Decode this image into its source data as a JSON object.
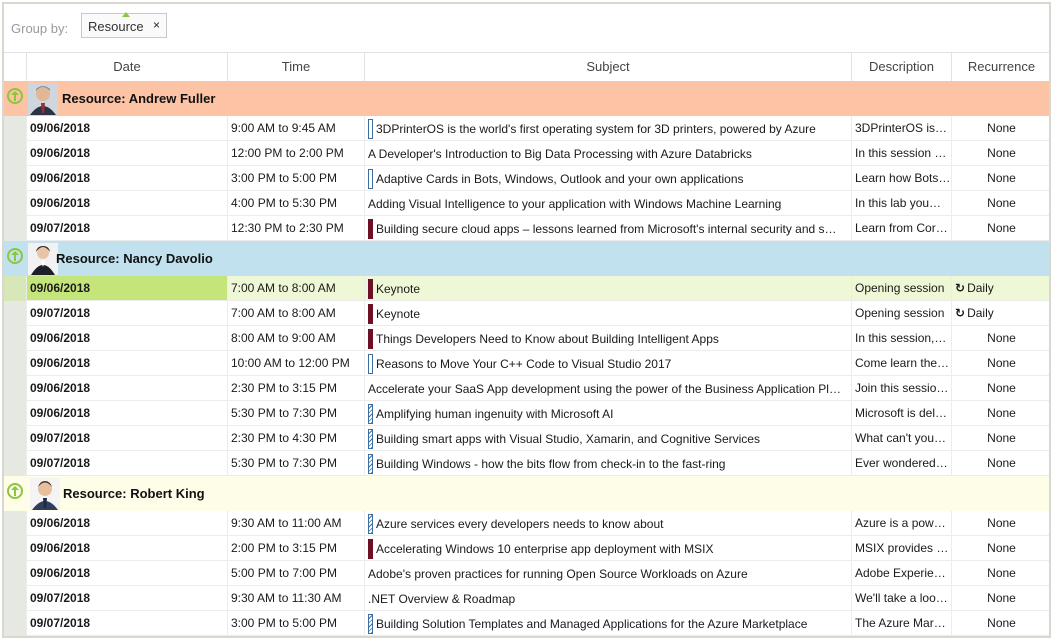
{
  "groupby": {
    "label": "Group by:",
    "chip_label": "Resource",
    "chip_close": "×"
  },
  "columns": [
    "Date",
    "Time",
    "Subject",
    "Description",
    "Recurrence"
  ],
  "groups": [
    {
      "title": "Resource: Andrew Fuller",
      "bg": "#fcc3a4",
      "rows": [
        {
          "date": "09/06/2018",
          "time": "9:00 AM to 9:45 AM",
          "cat": "hollow",
          "subject": "3DPrinterOS is the world's first operating system for 3D printers, powered by Azure",
          "description": "3DPrinterOS is…",
          "recurrence": "None"
        },
        {
          "date": "09/06/2018",
          "time": "12:00 PM to 2:00 PM",
          "cat": "none",
          "subject": "A Developer's Introduction to Big Data Processing with Azure Databricks",
          "description": "In this session y…",
          "recurrence": "None"
        },
        {
          "date": "09/06/2018",
          "time": "3:00 PM to 5:00 PM",
          "cat": "hollow",
          "subject": "Adaptive Cards in Bots, Windows, Outlook and your own applications",
          "description": "Learn how Bots…",
          "recurrence": "None"
        },
        {
          "date": "09/06/2018",
          "time": "4:00 PM to 5:30 PM",
          "cat": "none",
          "subject": "Adding Visual Intelligence to your application with Windows Machine Learning",
          "description": "In this lab you…",
          "recurrence": "None"
        },
        {
          "date": "09/07/2018",
          "time": "12:30 PM to 2:30 PM",
          "cat": "solid",
          "subject": "Building secure cloud apps – lessons learned from Microsoft's internal security and s…",
          "description": "Learn from Cor…",
          "recurrence": "None"
        }
      ]
    },
    {
      "title": "Resource: Nancy Davolio",
      "bg": "#c1e1ee",
      "rows": [
        {
          "date": "09/06/2018",
          "time": "7:00 AM to 8:00 AM",
          "cat": "solid",
          "subject": "Keynote",
          "description": "Opening session",
          "recurrence": "Daily",
          "recurring": true,
          "selected": true
        },
        {
          "date": "09/07/2018",
          "time": "7:00 AM to 8:00 AM",
          "cat": "solid",
          "subject": "Keynote",
          "description": "Opening session",
          "recurrence": "Daily",
          "recurring": true
        },
        {
          "date": "09/06/2018",
          "time": "8:00 AM to 9:00 AM",
          "cat": "solid",
          "subject": "Things Developers Need to Know about Building Intelligent Apps",
          "description": "In this session,…",
          "recurrence": "None"
        },
        {
          "date": "09/06/2018",
          "time": "10:00 AM to 12:00 PM",
          "cat": "hollow",
          "subject": "Reasons to Move Your C++ Code to Visual Studio 2017",
          "description": "Come learn the…",
          "recurrence": "None"
        },
        {
          "date": "09/06/2018",
          "time": "2:30 PM to 3:15 PM",
          "cat": "none",
          "subject": "Accelerate your SaaS App development using the power of the Business Application Pl…",
          "description": "Join this sessio…",
          "recurrence": "None"
        },
        {
          "date": "09/06/2018",
          "time": "5:30 PM to 7:30 PM",
          "cat": "hatch",
          "subject": "Amplifying human ingenuity with Microsoft AI",
          "description": "Microsoft is del…",
          "recurrence": "None"
        },
        {
          "date": "09/07/2018",
          "time": "2:30 PM to 4:30 PM",
          "cat": "hatch",
          "subject": "Building smart apps with Visual Studio, Xamarin, and Cognitive Services",
          "description": "What can't you…",
          "recurrence": "None"
        },
        {
          "date": "09/07/2018",
          "time": "5:30 PM to 7:30 PM",
          "cat": "hatch",
          "subject": "Building Windows - how the bits flow from check-in to the fast-ring",
          "description": "Ever wondered…",
          "recurrence": "None"
        }
      ]
    },
    {
      "title": "Resource: Robert King",
      "bg": "#fefde7",
      "rows": [
        {
          "date": "09/06/2018",
          "time": "9:30 AM to 11:00 AM",
          "cat": "hatch",
          "subject": "Azure services every developers needs to know about",
          "description": "Azure is a powe…",
          "recurrence": "None"
        },
        {
          "date": "09/06/2018",
          "time": "2:00 PM to 3:15 PM",
          "cat": "solid",
          "subject": "Accelerating Windows 10 enterprise app deployment with MSIX",
          "description": "MSIX provides I…",
          "recurrence": "None"
        },
        {
          "date": "09/06/2018",
          "time": "5:00 PM to 7:00 PM",
          "cat": "none",
          "subject": "Adobe's proven practices for running Open Source Workloads on Azure",
          "description": "Adobe Experien…",
          "recurrence": "None"
        },
        {
          "date": "09/07/2018",
          "time": "9:30 AM to 11:30 AM",
          "cat": "none",
          "subject": ".NET Overview & Roadmap",
          "description": "We'll take a loo…",
          "recurrence": "None"
        },
        {
          "date": "09/07/2018",
          "time": "3:00 PM to 5:00 PM",
          "cat": "hatch",
          "subject": "Building Solution Templates and Managed Applications for the Azure Marketplace",
          "description": "The Azure Mark…",
          "recurrence": "None"
        }
      ]
    }
  ]
}
